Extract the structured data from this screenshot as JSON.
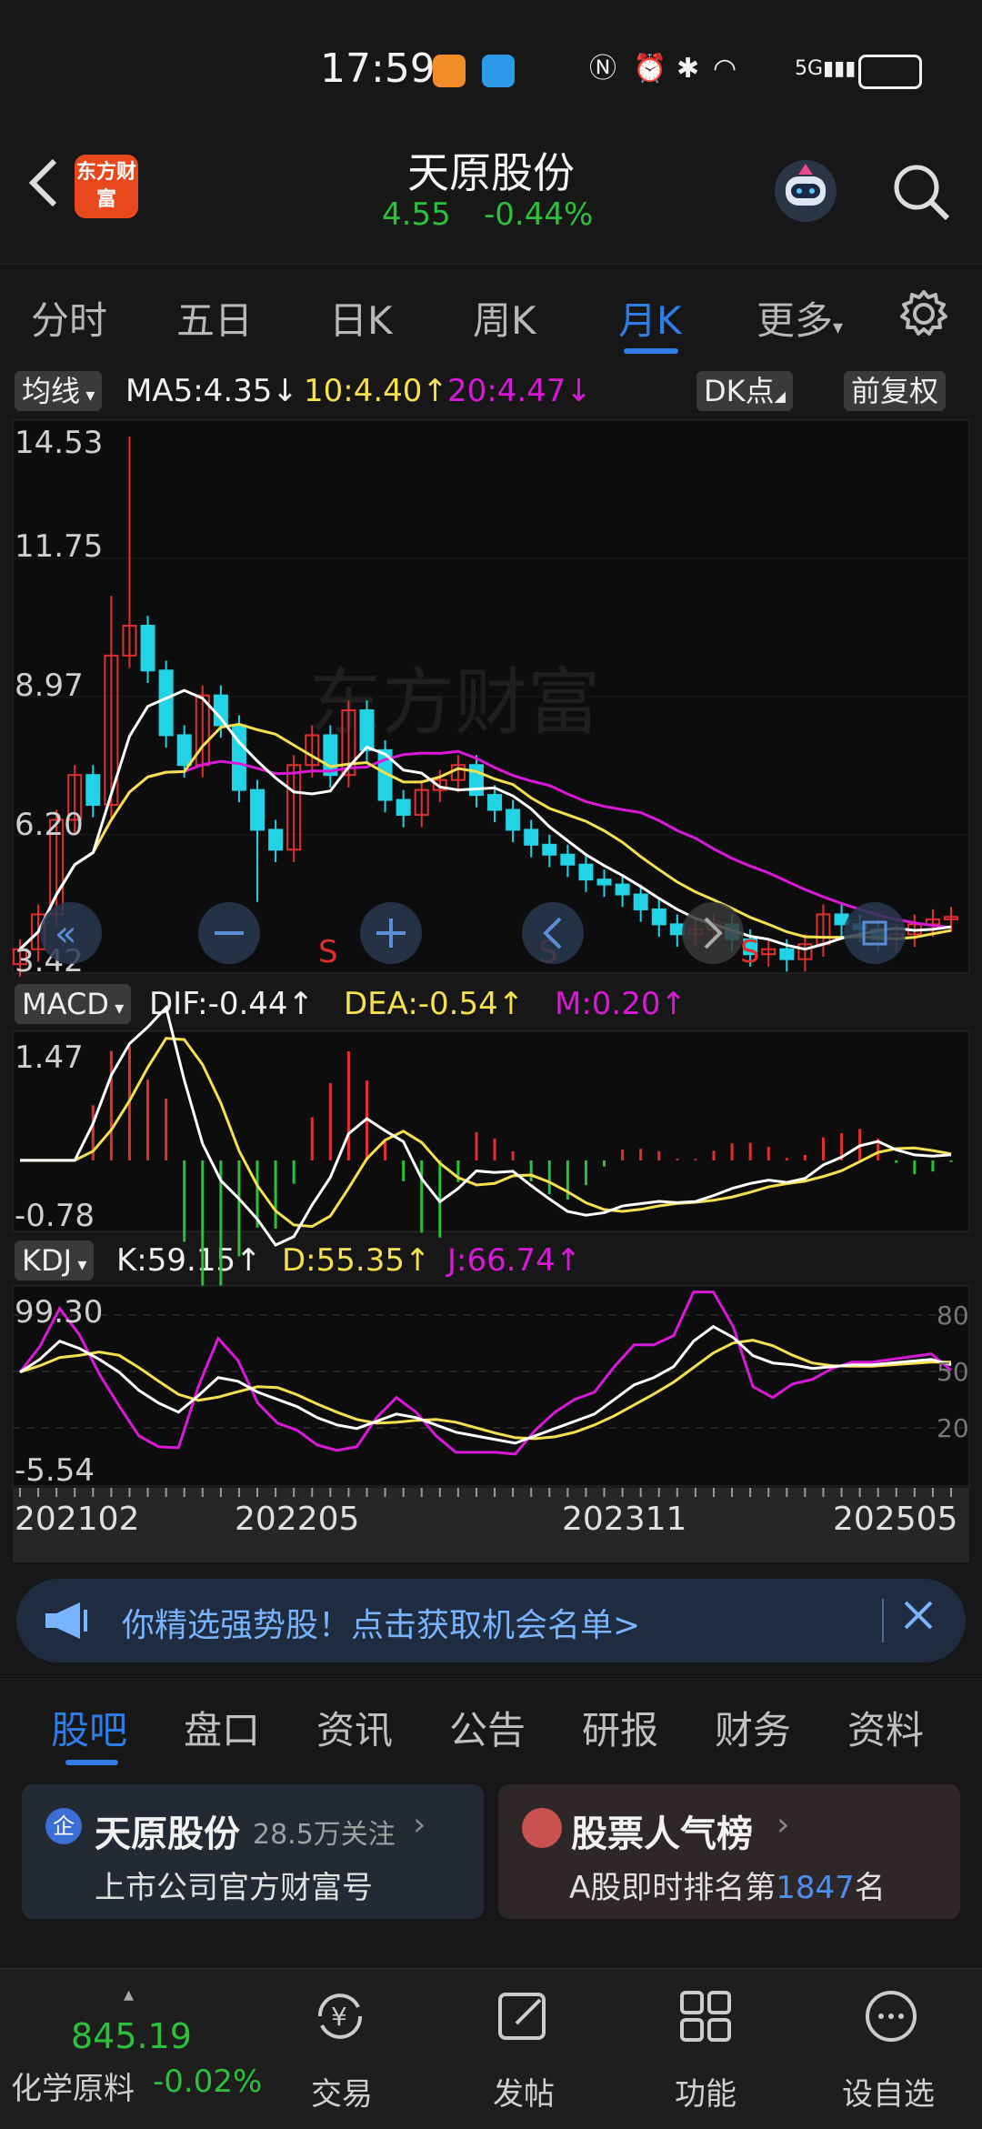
{
  "status_bar": {
    "time": "17:59",
    "network": "5G"
  },
  "header": {
    "back_icon": "chevron-left-icon",
    "app_logo_text": "东方财富",
    "stock_name": "天原股份",
    "price": "4.55",
    "change_pct": "-0.44%"
  },
  "tabs": [
    {
      "label": "分时"
    },
    {
      "label": "五日"
    },
    {
      "label": "日K"
    },
    {
      "label": "周K"
    },
    {
      "label": "月K",
      "active": true
    },
    {
      "label": "更多"
    }
  ],
  "settings_icon": "gear-icon",
  "ma_row": {
    "selector": "均线",
    "ma5": "MA5:4.35",
    "ma10": "10:4.40",
    "ma20": "20:4.47",
    "dk_button": "DK点",
    "adjust_button": "前复权"
  },
  "macd_row": {
    "selector": "MACD",
    "dif": "DIF:-0.44",
    "dea": "DEA:-0.54",
    "m": "M:0.20"
  },
  "kdj_row": {
    "selector": "KDJ",
    "k": "K:59.15",
    "d": "D:55.35",
    "j": "J:66.74"
  },
  "watermark": "东方财富",
  "chart_data": [
    {
      "type": "candlestick",
      "title": "",
      "y_ticks": [
        "14.53",
        "11.75",
        "8.97",
        "6.20",
        "3.42"
      ],
      "ylim": [
        3.42,
        14.53
      ],
      "x_ticks": [
        "202102",
        "202205",
        "202311",
        "202505"
      ],
      "series": [
        {
          "name": "MA5",
          "last_value": 4.35,
          "color": "#ffffff"
        },
        {
          "name": "MA10",
          "last_value": 4.4,
          "color": "#f5e050"
        },
        {
          "name": "MA20",
          "last_value": 4.47,
          "color": "#d81ad8"
        }
      ],
      "markers": [
        "S",
        "S",
        "S"
      ]
    },
    {
      "type": "bar",
      "title": "MACD",
      "y_ticks": [
        "1.47",
        "-0.78"
      ],
      "ylim": [
        -0.78,
        1.47
      ],
      "series": [
        {
          "name": "DIF",
          "last_value": -0.44
        },
        {
          "name": "DEA",
          "last_value": -0.54
        },
        {
          "name": "M",
          "last_value": 0.2
        }
      ]
    },
    {
      "type": "line",
      "title": "KDJ",
      "y_ticks_left": [
        "99.30",
        "-5.54"
      ],
      "y_ticks_right": [
        "80",
        "50",
        "20"
      ],
      "ylim": [
        -5.54,
        99.3
      ],
      "series": [
        {
          "name": "K",
          "last_value": 59.15
        },
        {
          "name": "D",
          "last_value": 55.35
        },
        {
          "name": "J",
          "last_value": 66.74
        }
      ]
    }
  ],
  "chart_controls": {
    "left": "chevrons-left-icon",
    "zoom_out": "minus-icon",
    "zoom_in": "plus-icon",
    "prev": "chevron-left-icon",
    "next": "chevron-right-icon",
    "expand": "expand-icon"
  },
  "banner": {
    "text": "你精选强势股！点击获取机会名单>",
    "icon": "megaphone-icon",
    "close_icon": "close-icon"
  },
  "bottom_tabs": [
    {
      "label": "股吧",
      "active": true
    },
    {
      "label": "盘口"
    },
    {
      "label": "资讯"
    },
    {
      "label": "公告"
    },
    {
      "label": "研报"
    },
    {
      "label": "财务"
    },
    {
      "label": "资料"
    }
  ],
  "cards": {
    "company": {
      "badge": "企",
      "title": "天原股份",
      "followers": "28.5万关注",
      "subtitle": "上市公司官方财富号"
    },
    "ranking": {
      "title": "股票人气榜",
      "subtitle_prefix": "A股即时排名第",
      "rank": "1847",
      "subtitle_suffix": "名"
    }
  },
  "bottom_bar": {
    "index_value": "845.19",
    "index_name": "化学原料",
    "index_change": "-0.02%",
    "items": [
      {
        "label": "交易",
        "icon": "yen-cycle-icon"
      },
      {
        "label": "发帖",
        "icon": "edit-icon"
      },
      {
        "label": "功能",
        "icon": "grid-icon"
      },
      {
        "label": "设自选",
        "icon": "more-icon"
      }
    ]
  },
  "colors": {
    "up": "#e03030",
    "down": "#22d3e6",
    "green": "#2ec03a",
    "accent": "#2e7de8"
  }
}
